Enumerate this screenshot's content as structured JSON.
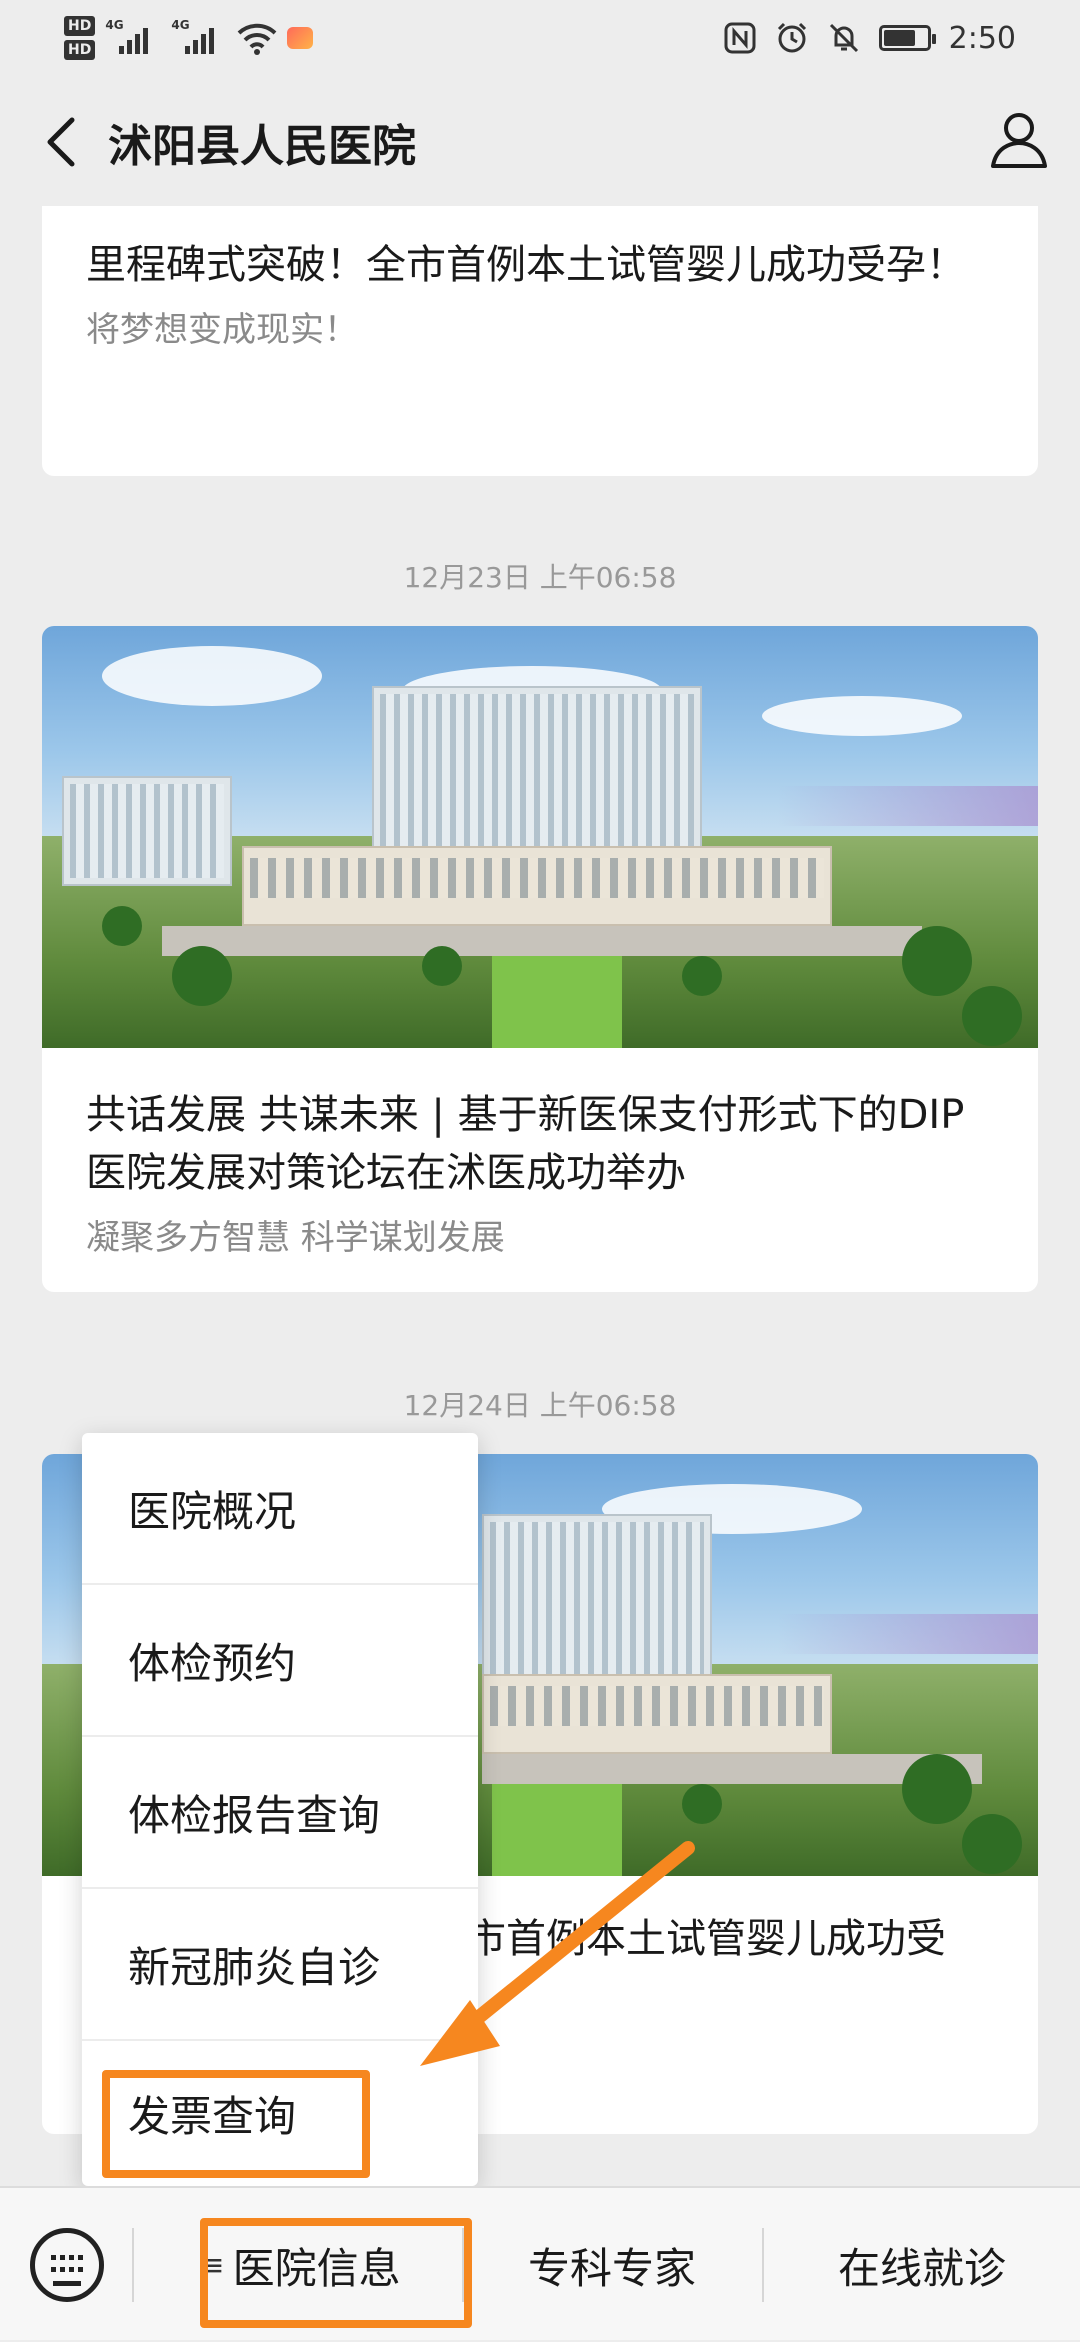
{
  "status_bar": {
    "hd1": "HD",
    "hd2": "HD",
    "net1": "4G",
    "net2": "4G",
    "time": "2:50",
    "icons": [
      "nfc-icon",
      "alarm-icon",
      "mute-icon",
      "battery-icon"
    ],
    "battery_level_percent": 75
  },
  "nav": {
    "title": "沭阳县人民医院",
    "back_icon": "chevron-left-icon",
    "profile_icon": "person-icon"
  },
  "feed": {
    "card1": {
      "title": "里程碑式突破！全市首例本土试管婴儿成功受孕！",
      "subtitle": "将梦想变成现实！"
    },
    "timestamp1": "12月23日 上午06:58",
    "card2": {
      "title": "共话发展 共谋未来 | 基于新医保支付形式下的DIP 医院发展对策论坛在沭医成功举办",
      "subtitle": "凝聚多方智慧 科学谋划发展"
    },
    "timestamp2": "12月24日 上午06:58",
    "card3": {
      "title_visible": "市首例本土试管婴儿成功受"
    }
  },
  "popup_menu": {
    "items": [
      {
        "label": "医院概况"
      },
      {
        "label": "体检预约"
      },
      {
        "label": "体检报告查询"
      },
      {
        "label": "新冠肺炎自诊"
      },
      {
        "label": "发票查询"
      }
    ],
    "highlighted_item": "发票查询"
  },
  "bottom_bar": {
    "keyboard_icon": "keyboard-icon",
    "tabs": [
      {
        "label": "医院信息",
        "highlighted": true,
        "icon": "list-icon"
      },
      {
        "label": "专科专家"
      },
      {
        "label": "在线就诊"
      }
    ]
  },
  "colors": {
    "highlight_orange": "#f6871f",
    "background": "#ededed"
  }
}
